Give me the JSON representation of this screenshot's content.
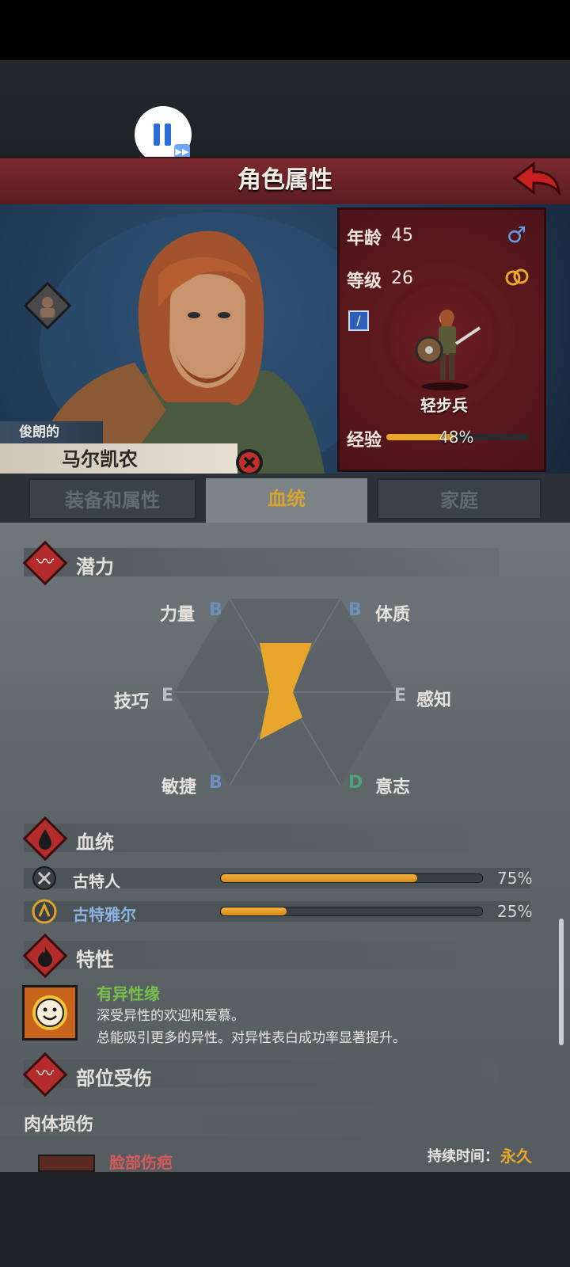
{
  "header": {
    "title": "角色属性"
  },
  "character": {
    "adjective": "俊朗的",
    "name": "马尔凯农",
    "age_label": "年龄",
    "age_value": "45",
    "level_label": "等级",
    "level_value": "26",
    "class_name": "轻步兵",
    "exp_label": "经验",
    "exp_percent_text": "48%",
    "exp_percent": 48
  },
  "tabs": [
    {
      "label": "装备和属性",
      "active": false
    },
    {
      "label": "血统",
      "active": true
    },
    {
      "label": "家庭",
      "active": false
    }
  ],
  "potential": {
    "title": "潜力",
    "stats": [
      {
        "name": "力量",
        "grade": "B",
        "grade_color": "#6f8fbf"
      },
      {
        "name": "体质",
        "grade": "B",
        "grade_color": "#6f8fbf"
      },
      {
        "name": "感知",
        "grade": "E",
        "grade_color": "#b8bcbf"
      },
      {
        "name": "意志",
        "grade": "D",
        "grade_color": "#4fa37a"
      },
      {
        "name": "敏捷",
        "grade": "B",
        "grade_color": "#6f8fbf"
      },
      {
        "name": "技巧",
        "grade": "E",
        "grade_color": "#b8bcbf"
      }
    ]
  },
  "bloodline": {
    "title": "血统",
    "items": [
      {
        "name": "古特人",
        "percent_text": "75%",
        "percent": 75,
        "name_color": "#e6e3df"
      },
      {
        "name": "古特雅尔",
        "percent_text": "25%",
        "percent": 25,
        "name_color": "#8db3e2"
      }
    ]
  },
  "traits": {
    "title": "特性",
    "items": [
      {
        "name": "有异性缘",
        "line1": "深受异性的欢迎和爱慕。",
        "line2": "总能吸引更多的异性。对异性表白成功率显著提升。"
      }
    ]
  },
  "injuries": {
    "title": "部位受伤",
    "subheading": "肉体损伤",
    "items": [
      {
        "name": "脸部伤疤",
        "duration_label": "持续时间：",
        "duration_value": "永久"
      }
    ]
  },
  "colors": {
    "accent_gold": "#e8a62a",
    "banner_red": "#6e2429",
    "trait_green": "#77c04a",
    "injury_red": "#d65a5a"
  }
}
